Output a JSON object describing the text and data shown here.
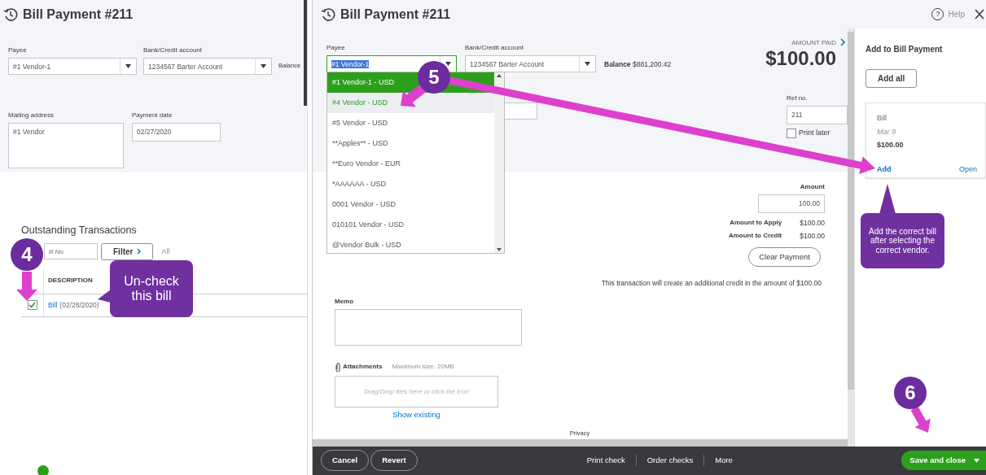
{
  "left_window": {
    "title": "Bill Payment #211",
    "payee": {
      "label": "Payee",
      "value": "#1 Vendor-1"
    },
    "bank_account": {
      "label": "Bank/Credit account",
      "value": "1234567 Barter Account"
    },
    "balance_label": "Balance",
    "mailing_address": {
      "label": "Mailing address",
      "value": "#1 Vendor"
    },
    "payment_date": {
      "label": "Payment date",
      "value": "02/27/2020"
    },
    "outstanding": {
      "title": "Outstanding Transactions",
      "search": {
        "placeholder": "ill No."
      },
      "filter_button": "Filter",
      "filter_scope": "All",
      "columns": [
        "DESCRIPTION"
      ],
      "rows": [
        {
          "checked": true,
          "link": "Bill",
          "detail": "(02/28/2020)"
        }
      ]
    }
  },
  "right_window": {
    "title": "Bill Payment #211",
    "help_icon": "?",
    "help": "Help",
    "payee": {
      "label": "Payee",
      "value": "#1 Vendor-1",
      "expanded": true
    },
    "payee_options": [
      {
        "label": "#1 Vendor-1 - USD",
        "selected": true,
        "highlighted": false
      },
      {
        "label": "#4 Vendor - USD",
        "selected": false,
        "highlighted": true
      },
      {
        "label": "#5 Vendor - USD",
        "selected": false,
        "highlighted": false
      },
      {
        "label": "**Apples** - USD",
        "selected": false,
        "highlighted": false
      },
      {
        "label": "**Euro Vendor - EUR",
        "selected": false,
        "highlighted": false
      },
      {
        "label": "*AAAAAA - USD",
        "selected": false,
        "highlighted": false
      },
      {
        "label": "0001 Vendor - USD",
        "selected": false,
        "highlighted": false
      },
      {
        "label": "010101 Vendor - USD",
        "selected": false,
        "highlighted": false
      },
      {
        "label": "@Vendor Bulk - USD",
        "selected": false,
        "highlighted": false
      }
    ],
    "bank_account": {
      "label": "Bank/Credit account",
      "value": "1234567 Barter Account"
    },
    "balance": {
      "label": "Balance",
      "value": "$881,200.42"
    },
    "amount_paid": {
      "label": "AMOUNT PAID",
      "value": "$100.00"
    },
    "ref_no": {
      "label": "Ref no.",
      "value": "211"
    },
    "print_later": {
      "label": "Print later",
      "checked": false
    },
    "amount": {
      "label": "Amount",
      "value": "100.00"
    },
    "totals": [
      {
        "label": "Amount to Apply",
        "value": "$100.00"
      },
      {
        "label": "Amount to Credit",
        "value": "$100.00"
      }
    ],
    "clear_button": "Clear Payment",
    "credit_note": "This transaction will create an additional credit in the amount of $100.00",
    "memo": {
      "label": "Memo"
    },
    "attachments": {
      "label": "Attachments",
      "max_size": "Maximum size: 20MB",
      "dropzone": "Drag/Drop files here or click the icon",
      "show_existing": "Show existing"
    },
    "privacy": "Privacy",
    "sidebar": {
      "title": "Add to Bill Payment",
      "add_all": "Add all",
      "cards": [
        {
          "type": "Bill",
          "date": "Mar 9",
          "amount": "$100.00",
          "add": "Add",
          "open": "Open"
        }
      ]
    },
    "footer": {
      "left_buttons": [
        "Cancel",
        "Revert"
      ],
      "actions": [
        "Print check",
        "Order checks",
        "More"
      ],
      "save_button": "Save and close"
    }
  },
  "annotations": {
    "steps": [
      "4",
      "5",
      "6"
    ],
    "callouts": [
      "Un-check this bill",
      "Add the correct bill after selecting the correct vendor."
    ]
  }
}
